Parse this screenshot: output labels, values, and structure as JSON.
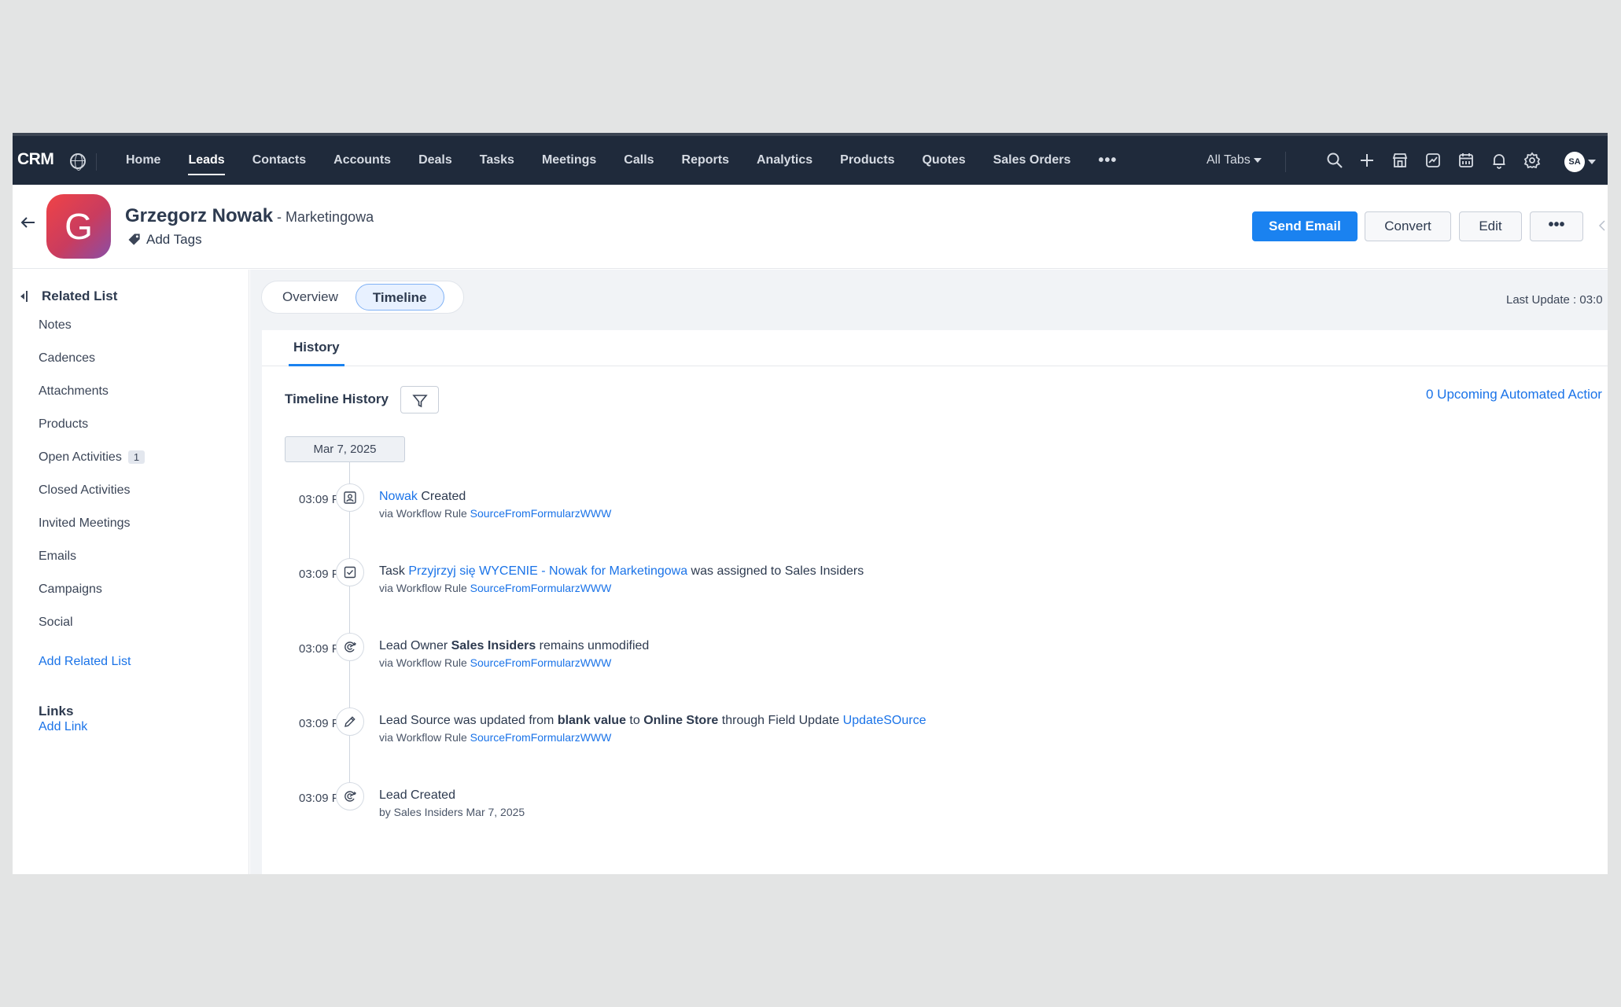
{
  "topnav": {
    "brand": "CRM",
    "tabs": [
      "Home",
      "Leads",
      "Contacts",
      "Accounts",
      "Deals",
      "Tasks",
      "Meetings",
      "Calls",
      "Reports",
      "Analytics",
      "Products",
      "Quotes",
      "Sales Orders"
    ],
    "active_tab": "Leads",
    "more_label": "•••",
    "all_tabs_label": "All Tabs",
    "avatar_initials": "SA",
    "icons": [
      "search-icon",
      "plus-icon",
      "marketplace-icon",
      "signals-icon",
      "calendar-icon",
      "bell-icon",
      "gear-icon"
    ]
  },
  "record": {
    "avatar_letter": "G",
    "name": "Grzegorz Nowak",
    "separator": " - ",
    "company": "Marketingowa",
    "add_tags_label": "Add Tags",
    "buttons": {
      "send_email": "Send Email",
      "convert": "Convert",
      "edit": "Edit",
      "more": "•••"
    }
  },
  "sidebar": {
    "title": "Related List",
    "items": [
      {
        "label": "Notes"
      },
      {
        "label": "Cadences"
      },
      {
        "label": "Attachments"
      },
      {
        "label": "Products"
      },
      {
        "label": "Open Activities",
        "badge": "1"
      },
      {
        "label": "Closed Activities"
      },
      {
        "label": "Invited Meetings"
      },
      {
        "label": "Emails"
      },
      {
        "label": "Campaigns"
      },
      {
        "label": "Social"
      }
    ],
    "add_related_list": "Add Related List",
    "links_title": "Links",
    "add_link": "Add Link"
  },
  "main": {
    "view_tabs": [
      "Overview",
      "Timeline"
    ],
    "active_view": "Timeline",
    "last_update": "Last Update : 03:0",
    "subtab": "History",
    "timeline_title": "Timeline History",
    "upcoming": "0 Upcoming Automated Actior",
    "date": "Mar 7, 2025",
    "entries": [
      {
        "time": "03:09 PM",
        "icon": "contact-card-icon",
        "parts": [
          {
            "t": "Nowak",
            "s": "link"
          },
          {
            "t": " Created",
            "s": "normal"
          }
        ],
        "sub_prefix": "via Workflow Rule ",
        "sub_link": "SourceFromFormularzWWW"
      },
      {
        "time": "03:09 PM",
        "icon": "task-check-icon",
        "parts": [
          {
            "t": "Task ",
            "s": "normal"
          },
          {
            "t": "Przyjrzyj się WYCENIE - Nowak for Marketingowa",
            "s": "link"
          },
          {
            "t": " was assigned to  Sales Insiders",
            "s": "normal"
          }
        ],
        "sub_prefix": "via Workflow Rule ",
        "sub_link": "SourceFromFormularzWWW"
      },
      {
        "time": "03:09 PM",
        "icon": "lead-target-icon",
        "parts": [
          {
            "t": "Lead Owner ",
            "s": "normal"
          },
          {
            "t": "Sales Insiders",
            "s": "bold"
          },
          {
            "t": " remains unmodified",
            "s": "normal"
          }
        ],
        "sub_prefix": "via Workflow Rule ",
        "sub_link": "SourceFromFormularzWWW"
      },
      {
        "time": "03:09 PM",
        "icon": "pencil-icon",
        "parts": [
          {
            "t": "Lead Source was updated from ",
            "s": "normal"
          },
          {
            "t": "blank value",
            "s": "bold"
          },
          {
            "t": " to ",
            "s": "normal"
          },
          {
            "t": "Online Store",
            "s": "bold"
          },
          {
            "t": " through Field Update ",
            "s": "normal"
          },
          {
            "t": "UpdateSOurce",
            "s": "link"
          }
        ],
        "sub_prefix": "via Workflow Rule ",
        "sub_link": "SourceFromFormularzWWW"
      },
      {
        "time": "03:09 PM",
        "icon": "lead-target-icon",
        "parts": [
          {
            "t": "Lead Created",
            "s": "normal"
          }
        ],
        "sub_prefix": "by Sales Insiders Mar 7, 2025",
        "sub_link": ""
      }
    ]
  },
  "colors": {
    "nav_bg": "#1f2a3b",
    "primary": "#1a82f0",
    "link": "#1a73e8"
  }
}
